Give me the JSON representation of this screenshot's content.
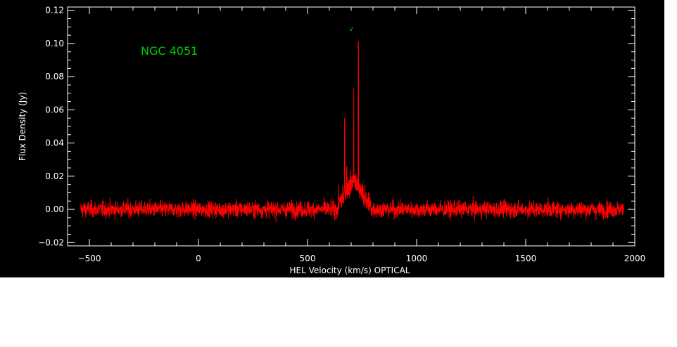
{
  "chart_data": {
    "type": "line",
    "title": "",
    "annotation": "NGC 4051",
    "marker_label": "v",
    "marker_x": 700,
    "xlabel": "HEL Velocity (km/s) OPTICAL",
    "ylabel": "Flux Density (Jy)",
    "xlim": [
      -600,
      2000
    ],
    "ylim": [
      -0.022,
      0.122
    ],
    "x_ticks": [
      -500,
      0,
      500,
      1000,
      1500,
      2000
    ],
    "x_tick_labels": [
      "−500",
      "0",
      "500",
      "1000",
      "1500",
      "2000"
    ],
    "y_ticks": [
      -0.02,
      0.0,
      0.02,
      0.04,
      0.06,
      0.08,
      0.1,
      0.12
    ],
    "y_tick_labels": [
      "−0.02",
      "0.00",
      "0.02",
      "0.04",
      "0.06",
      "0.08",
      "0.10",
      "0.12"
    ],
    "series": [
      {
        "color": "#ff0000",
        "noise_rms": 0.0035,
        "x_range": [
          -540,
          1950
        ],
        "features": [
          {
            "x": 670,
            "y": 0.055
          },
          {
            "x": 680,
            "y": 0.026
          },
          {
            "x": 700,
            "y": 0.02
          },
          {
            "x": 712,
            "y": 0.073
          },
          {
            "x": 722,
            "y": 0.022
          },
          {
            "x": 733,
            "y": 0.101
          },
          {
            "x": 745,
            "y": 0.015
          }
        ]
      }
    ],
    "colors": {
      "background": "#000000",
      "axes": "#ffffff",
      "annotation": "#00cc00",
      "series": "#ff0000"
    }
  }
}
